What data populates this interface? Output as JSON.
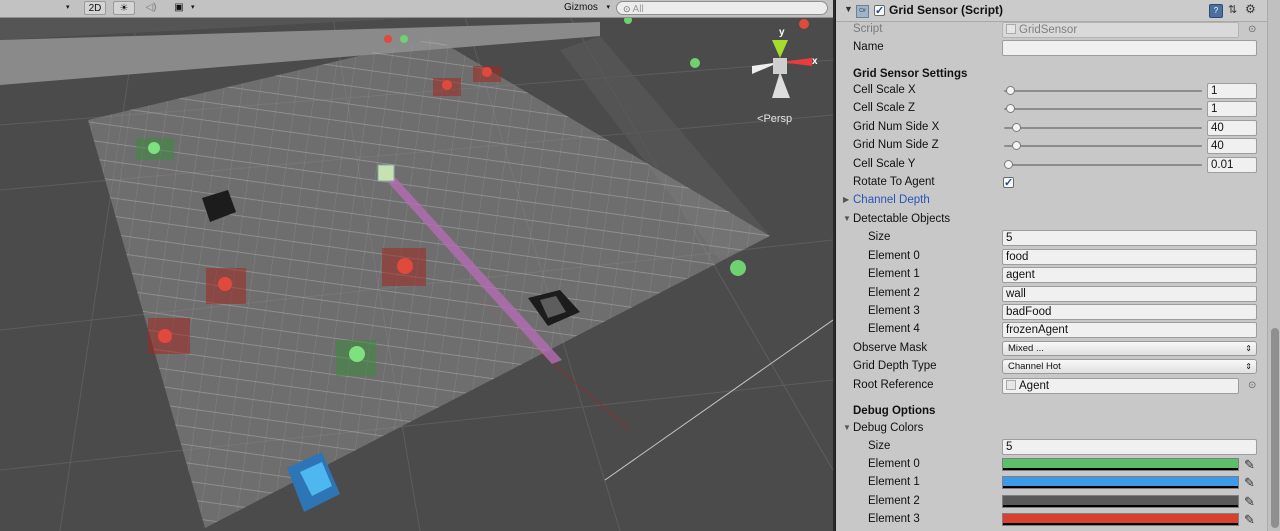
{
  "scene": {
    "toolbar": {
      "mode_2d": "2D",
      "gizmos": "Gizmos",
      "search_placeholder": "All",
      "icons": [
        "light-toggle-icon",
        "audio-toggle-icon",
        "effects-toggle-icon",
        "search-icon"
      ]
    },
    "persp_label": "Persp",
    "gizmo_axes": {
      "y": "y",
      "x": "x"
    }
  },
  "inspector": {
    "component_title": "Grid Sensor (Script)",
    "component_enabled": true,
    "script_label": "Script",
    "script_value": "GridSensor",
    "name_label": "Name",
    "name_value": "",
    "settings_header": "Grid Sensor Settings",
    "cell_scale_x": {
      "label": "Cell Scale X",
      "value": "1",
      "fraction": 0.01
    },
    "cell_scale_z": {
      "label": "Cell Scale Z",
      "value": "1",
      "fraction": 0.01
    },
    "grid_num_side_x": {
      "label": "Grid Num Side X",
      "value": "40",
      "fraction": 0.04
    },
    "grid_num_side_z": {
      "label": "Grid Num Side Z",
      "value": "40",
      "fraction": 0.04
    },
    "cell_scale_y": {
      "label": "Cell Scale Y",
      "value": "0.01",
      "fraction": 0.0
    },
    "rotate_to_agent": {
      "label": "Rotate To Agent",
      "checked": true
    },
    "channel_depth": "Channel Depth",
    "detectable_objects": {
      "label": "Detectable Objects",
      "size_label": "Size",
      "size": "5",
      "elements": [
        {
          "label": "Element 0",
          "value": "food"
        },
        {
          "label": "Element 1",
          "value": "agent"
        },
        {
          "label": "Element 2",
          "value": "wall"
        },
        {
          "label": "Element 3",
          "value": "badFood"
        },
        {
          "label": "Element 4",
          "value": "frozenAgent"
        }
      ]
    },
    "observe_mask": {
      "label": "Observe Mask",
      "value": "Mixed ..."
    },
    "grid_depth_type": {
      "label": "Grid Depth Type",
      "value": "Channel Hot"
    },
    "root_reference": {
      "label": "Root Reference",
      "value": "Agent"
    },
    "debug_header": "Debug Options",
    "debug_colors": {
      "label": "Debug Colors",
      "size_label": "Size",
      "size": "5",
      "elements": [
        {
          "label": "Element 0",
          "color": "#5cbf6a"
        },
        {
          "label": "Element 1",
          "color": "#3b9bea"
        },
        {
          "label": "Element 2",
          "color": "#595959"
        },
        {
          "label": "Element 3",
          "color": "#d9412f"
        }
      ]
    }
  }
}
